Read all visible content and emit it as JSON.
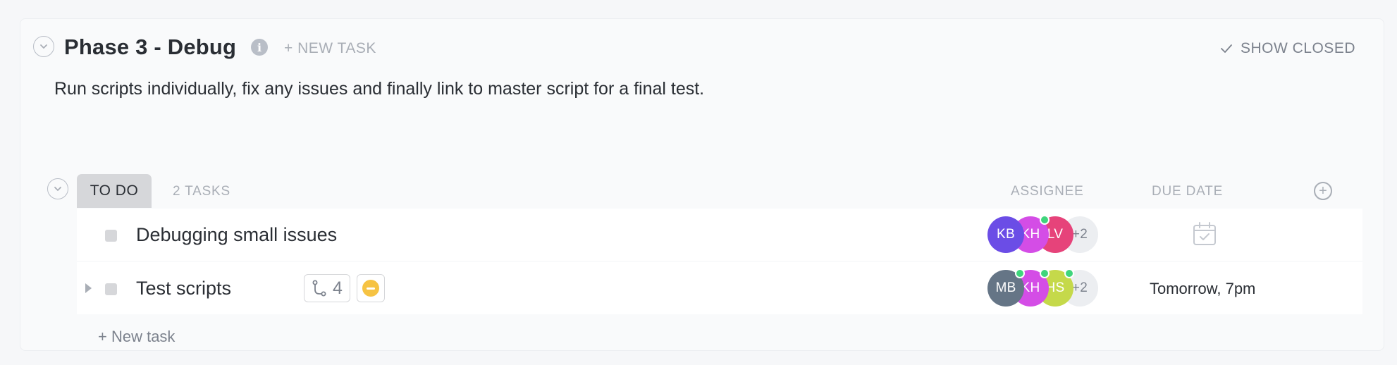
{
  "list": {
    "title": "Phase 3 - Debug",
    "new_task_label": "+ NEW TASK",
    "show_closed_label": "SHOW CLOSED",
    "description": "Run scripts individually, fix any issues and finally link to master script for a final test."
  },
  "group": {
    "status": "TO DO",
    "task_count": "2 TASKS",
    "columns": {
      "assignee": "ASSIGNEE",
      "due_date": "DUE DATE"
    }
  },
  "tasks": [
    {
      "name": "Debugging small issues",
      "assignees": [
        {
          "initials": "KB",
          "color": "#6b4de6",
          "online": false
        },
        {
          "initials": "KH",
          "color": "#d44de6",
          "online": true
        },
        {
          "initials": "LV",
          "color": "#e6437a",
          "online": false
        }
      ],
      "more_assignees": "+2",
      "due": "",
      "due_icon": "calendar-icon"
    },
    {
      "name": "Test scripts",
      "subtask_count": "4",
      "priority": "normal",
      "priority_color": "#f6c343",
      "assignees": [
        {
          "initials": "MB",
          "color": "#657586",
          "online": true
        },
        {
          "initials": "KH",
          "color": "#d44de6",
          "online": true
        },
        {
          "initials": "HS",
          "color": "#c5d94a",
          "online": true
        }
      ],
      "more_assignees": "+2",
      "due": "Tomorrow, 7pm"
    }
  ],
  "footer": {
    "new_task_label": "+ New task"
  },
  "colors": {
    "accent_gray": "#a9aeb6",
    "status_bg": "#d6d7da",
    "online": "#3fd57c"
  }
}
